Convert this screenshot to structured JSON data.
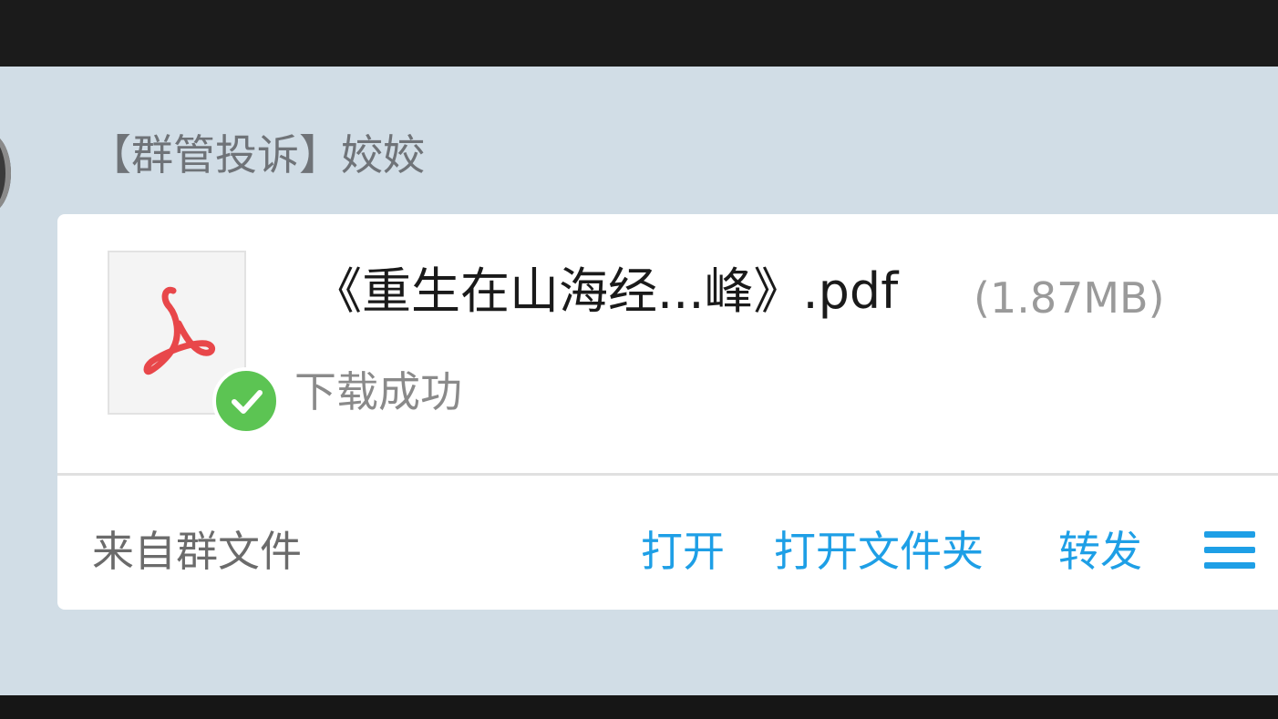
{
  "message": {
    "sender": "【群管投诉】姣姣",
    "file": {
      "icon": "pdf-icon",
      "name": "《重生在山海经...峰》.pdf",
      "size": "(1.87MB)",
      "status": "下载成功",
      "status_icon": "check-circle-icon"
    },
    "footer": {
      "source": "来自群文件",
      "actions": {
        "open": "打开",
        "open_folder": "打开文件夹",
        "forward": "转发"
      },
      "menu_icon": "menu-icon"
    }
  },
  "colors": {
    "chat_background": "#d1dde6",
    "link": "#1e9fe6",
    "success": "#5cc453",
    "pdf_red": "#e8474a"
  }
}
